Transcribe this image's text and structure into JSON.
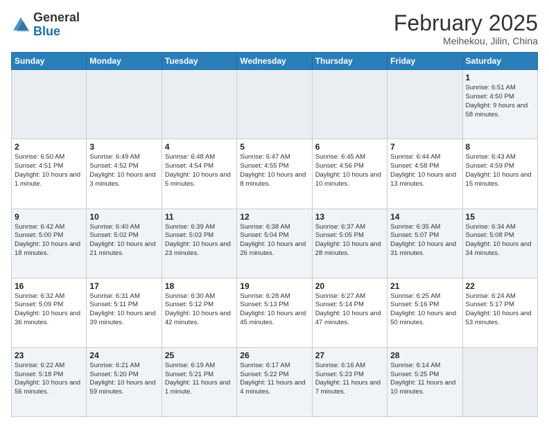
{
  "header": {
    "logo_general": "General",
    "logo_blue": "Blue",
    "month_year": "February 2025",
    "location": "Meihekou, Jilin, China"
  },
  "weekdays": [
    "Sunday",
    "Monday",
    "Tuesday",
    "Wednesday",
    "Thursday",
    "Friday",
    "Saturday"
  ],
  "weeks": [
    [
      {
        "day": "",
        "info": ""
      },
      {
        "day": "",
        "info": ""
      },
      {
        "day": "",
        "info": ""
      },
      {
        "day": "",
        "info": ""
      },
      {
        "day": "",
        "info": ""
      },
      {
        "day": "",
        "info": ""
      },
      {
        "day": "1",
        "info": "Sunrise: 6:51 AM\nSunset: 4:50 PM\nDaylight: 9 hours and 58 minutes."
      }
    ],
    [
      {
        "day": "2",
        "info": "Sunrise: 6:50 AM\nSunset: 4:51 PM\nDaylight: 10 hours and 1 minute."
      },
      {
        "day": "3",
        "info": "Sunrise: 6:49 AM\nSunset: 4:52 PM\nDaylight: 10 hours and 3 minutes."
      },
      {
        "day": "4",
        "info": "Sunrise: 6:48 AM\nSunset: 4:54 PM\nDaylight: 10 hours and 5 minutes."
      },
      {
        "day": "5",
        "info": "Sunrise: 6:47 AM\nSunset: 4:55 PM\nDaylight: 10 hours and 8 minutes."
      },
      {
        "day": "6",
        "info": "Sunrise: 6:45 AM\nSunset: 4:56 PM\nDaylight: 10 hours and 10 minutes."
      },
      {
        "day": "7",
        "info": "Sunrise: 6:44 AM\nSunset: 4:58 PM\nDaylight: 10 hours and 13 minutes."
      },
      {
        "day": "8",
        "info": "Sunrise: 6:43 AM\nSunset: 4:59 PM\nDaylight: 10 hours and 15 minutes."
      }
    ],
    [
      {
        "day": "9",
        "info": "Sunrise: 6:42 AM\nSunset: 5:00 PM\nDaylight: 10 hours and 18 minutes."
      },
      {
        "day": "10",
        "info": "Sunrise: 6:40 AM\nSunset: 5:02 PM\nDaylight: 10 hours and 21 minutes."
      },
      {
        "day": "11",
        "info": "Sunrise: 6:39 AM\nSunset: 5:03 PM\nDaylight: 10 hours and 23 minutes."
      },
      {
        "day": "12",
        "info": "Sunrise: 6:38 AM\nSunset: 5:04 PM\nDaylight: 10 hours and 26 minutes."
      },
      {
        "day": "13",
        "info": "Sunrise: 6:37 AM\nSunset: 5:05 PM\nDaylight: 10 hours and 28 minutes."
      },
      {
        "day": "14",
        "info": "Sunrise: 6:35 AM\nSunset: 5:07 PM\nDaylight: 10 hours and 31 minutes."
      },
      {
        "day": "15",
        "info": "Sunrise: 6:34 AM\nSunset: 5:08 PM\nDaylight: 10 hours and 34 minutes."
      }
    ],
    [
      {
        "day": "16",
        "info": "Sunrise: 6:32 AM\nSunset: 5:09 PM\nDaylight: 10 hours and 36 minutes."
      },
      {
        "day": "17",
        "info": "Sunrise: 6:31 AM\nSunset: 5:11 PM\nDaylight: 10 hours and 39 minutes."
      },
      {
        "day": "18",
        "info": "Sunrise: 6:30 AM\nSunset: 5:12 PM\nDaylight: 10 hours and 42 minutes."
      },
      {
        "day": "19",
        "info": "Sunrise: 6:28 AM\nSunset: 5:13 PM\nDaylight: 10 hours and 45 minutes."
      },
      {
        "day": "20",
        "info": "Sunrise: 6:27 AM\nSunset: 5:14 PM\nDaylight: 10 hours and 47 minutes."
      },
      {
        "day": "21",
        "info": "Sunrise: 6:25 AM\nSunset: 5:16 PM\nDaylight: 10 hours and 50 minutes."
      },
      {
        "day": "22",
        "info": "Sunrise: 6:24 AM\nSunset: 5:17 PM\nDaylight: 10 hours and 53 minutes."
      }
    ],
    [
      {
        "day": "23",
        "info": "Sunrise: 6:22 AM\nSunset: 5:18 PM\nDaylight: 10 hours and 56 minutes."
      },
      {
        "day": "24",
        "info": "Sunrise: 6:21 AM\nSunset: 5:20 PM\nDaylight: 10 hours and 59 minutes."
      },
      {
        "day": "25",
        "info": "Sunrise: 6:19 AM\nSunset: 5:21 PM\nDaylight: 11 hours and 1 minute."
      },
      {
        "day": "26",
        "info": "Sunrise: 6:17 AM\nSunset: 5:22 PM\nDaylight: 11 hours and 4 minutes."
      },
      {
        "day": "27",
        "info": "Sunrise: 6:16 AM\nSunset: 5:23 PM\nDaylight: 11 hours and 7 minutes."
      },
      {
        "day": "28",
        "info": "Sunrise: 6:14 AM\nSunset: 5:25 PM\nDaylight: 11 hours and 10 minutes."
      },
      {
        "day": "",
        "info": ""
      }
    ]
  ]
}
